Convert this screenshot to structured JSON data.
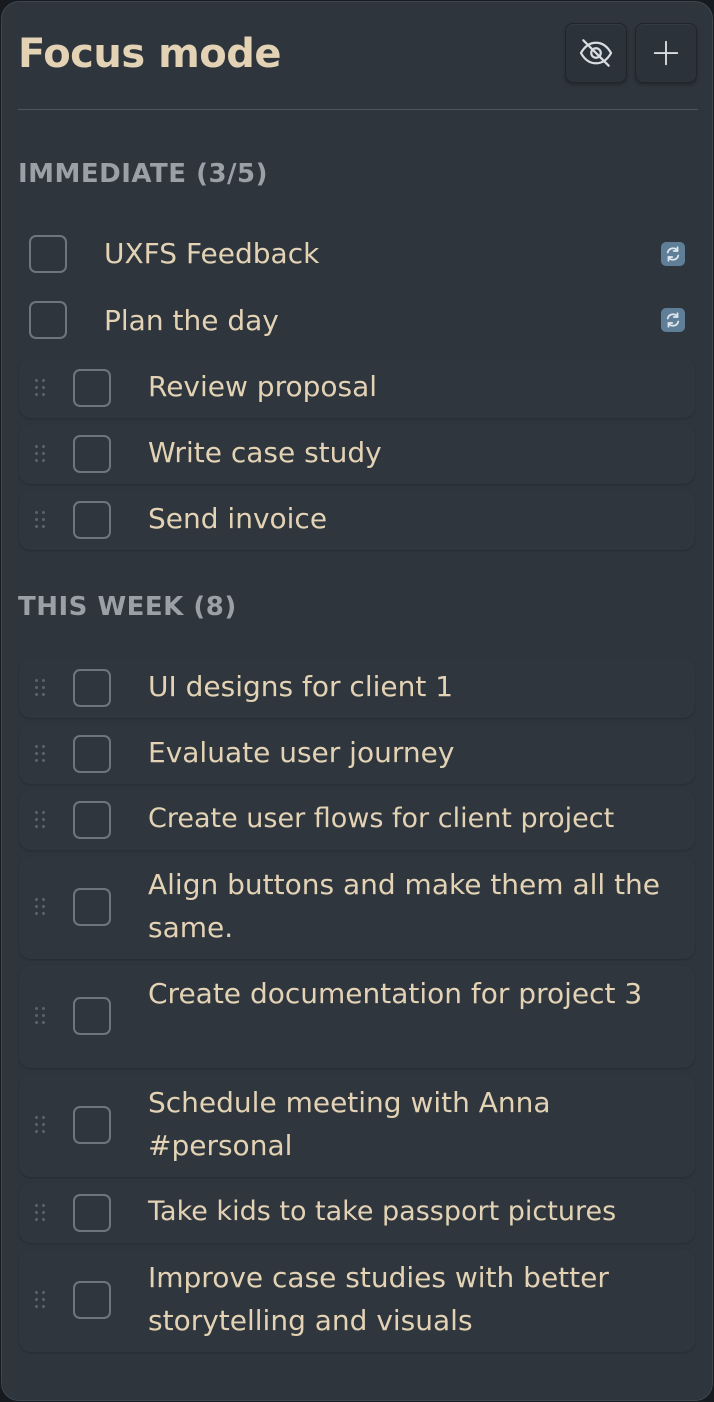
{
  "header": {
    "title": "Focus mode",
    "hide_icon": "eye-off-icon",
    "add_icon": "plus-icon"
  },
  "sections": [
    {
      "title": "IMMEDIATE (3/5)",
      "tasks": [
        {
          "label": "UXFS Feedback",
          "done": false,
          "recurring": true,
          "draggable": false
        },
        {
          "label": "Plan the day",
          "done": false,
          "recurring": true,
          "draggable": false
        },
        {
          "label": "Review proposal",
          "done": false,
          "recurring": false,
          "draggable": true
        },
        {
          "label": "Write case study",
          "done": false,
          "recurring": false,
          "draggable": true
        },
        {
          "label": "Send invoice",
          "done": false,
          "recurring": false,
          "draggable": true
        }
      ]
    },
    {
      "title": "THIS WEEK (8)",
      "tasks": [
        {
          "label": "UI designs for client 1",
          "done": false,
          "recurring": false,
          "draggable": true
        },
        {
          "label": "Evaluate user journey",
          "done": false,
          "recurring": false,
          "draggable": true
        },
        {
          "label": "Create user flows for client project",
          "done": false,
          "recurring": false,
          "draggable": true
        },
        {
          "label": "Align buttons and make them all the same.",
          "done": false,
          "recurring": false,
          "draggable": true
        },
        {
          "label": "Create documentation for project 3",
          "done": false,
          "recurring": false,
          "draggable": true
        },
        {
          "label": "Schedule meeting with Anna #personal",
          "done": false,
          "recurring": false,
          "draggable": true
        },
        {
          "label": "Take kids to take passport pictures",
          "done": false,
          "recurring": false,
          "draggable": true
        },
        {
          "label": "Improve case studies with better storytelling and visuals",
          "done": false,
          "recurring": false,
          "draggable": true
        }
      ]
    }
  ],
  "colors": {
    "panel": "#2e353d",
    "text": "#e3d3b4",
    "section_heading": "#9aa0a6",
    "recurring_badge": "#5f7f98"
  }
}
